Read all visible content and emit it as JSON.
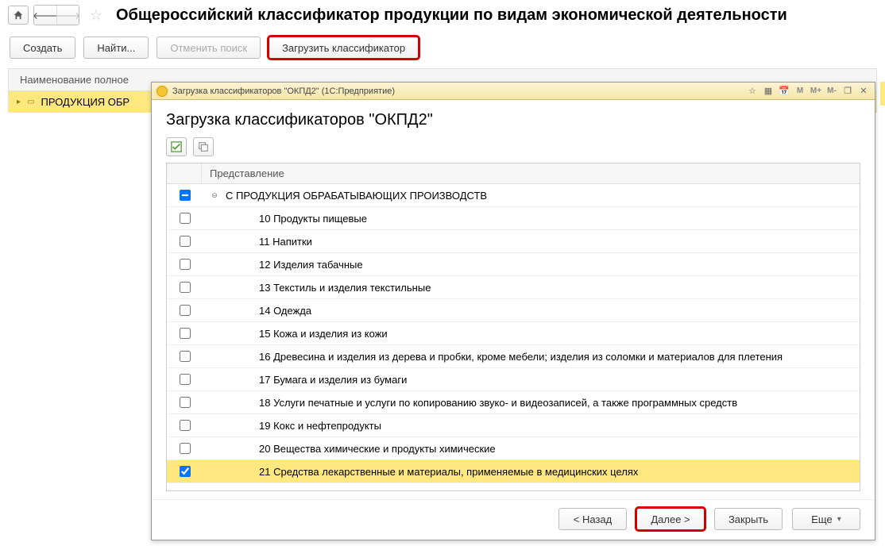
{
  "header": {
    "title": "Общероссийский классификатор продукции по видам экономической деятельности"
  },
  "toolbar": {
    "create": "Создать",
    "find": "Найти...",
    "cancel_search": "Отменить поиск",
    "load_classifier": "Загрузить классификатор"
  },
  "bg_list": {
    "header": "Наименование полное",
    "row0": "ПРОДУКЦИЯ ОБР"
  },
  "dialog": {
    "window_title": "Загрузка классификаторов \"ОКПД2\" (1С:Предприятие)",
    "heading": "Загрузка классификаторов \"ОКПД2\"",
    "title_icons": {
      "m": "M",
      "mplus": "M+",
      "mminus": "M-"
    },
    "column_header": "Представление",
    "rows": [
      {
        "lvl": 0,
        "checked": "mixed",
        "expander": "⊖",
        "label": "С ПРОДУКЦИЯ ОБРАБАТЫВАЮЩИХ ПРОИЗВОДСТВ"
      },
      {
        "lvl": 1,
        "checked": false,
        "label": "10 Продукты пищевые"
      },
      {
        "lvl": 1,
        "checked": false,
        "label": "11 Напитки"
      },
      {
        "lvl": 1,
        "checked": false,
        "label": "12 Изделия табачные"
      },
      {
        "lvl": 1,
        "checked": false,
        "label": "13 Текстиль и изделия текстильные"
      },
      {
        "lvl": 1,
        "checked": false,
        "label": "14 Одежда"
      },
      {
        "lvl": 1,
        "checked": false,
        "label": "15 Кожа и изделия из кожи"
      },
      {
        "lvl": 1,
        "checked": false,
        "label": "16 Древесина и изделия из дерева и пробки, кроме мебели; изделия из соломки и материалов для плетения"
      },
      {
        "lvl": 1,
        "checked": false,
        "label": "17 Бумага и изделия из бумаги"
      },
      {
        "lvl": 1,
        "checked": false,
        "label": "18 Услуги печатные и услуги по копированию звуко- и видеозаписей, а также программных средств"
      },
      {
        "lvl": 1,
        "checked": false,
        "label": "19 Кокс и нефтепродукты"
      },
      {
        "lvl": 1,
        "checked": false,
        "label": "20 Вещества химические и продукты химические"
      },
      {
        "lvl": 1,
        "checked": true,
        "selected": true,
        "label": "21 Средства лекарственные и материалы, применяемые в медицинских целях"
      }
    ],
    "footer": {
      "back": "< Назад",
      "next": "Далее >",
      "close": "Закрыть",
      "more": "Еще"
    }
  }
}
